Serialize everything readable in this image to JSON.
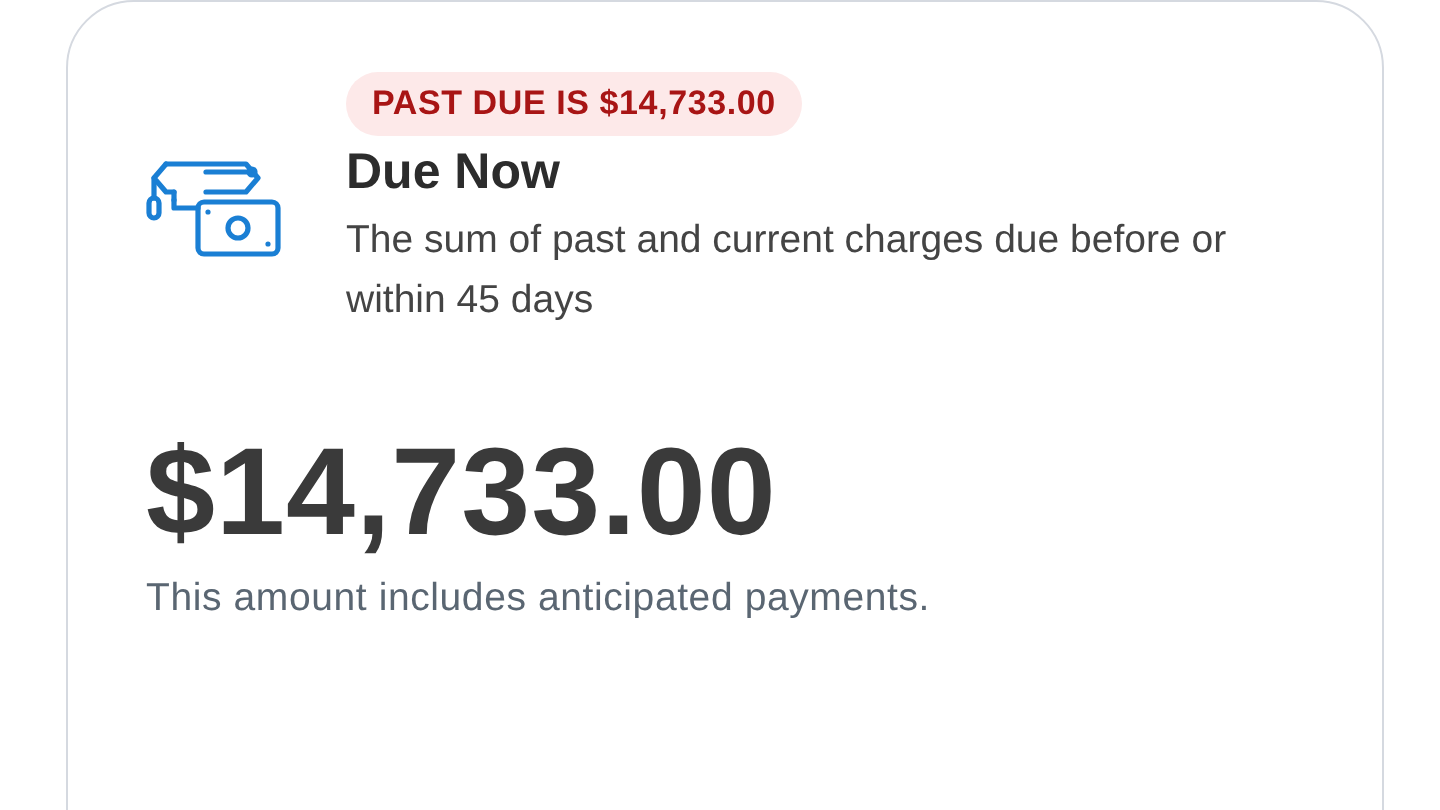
{
  "card": {
    "badge": "PAST DUE IS $14,733.00",
    "title": "Due Now",
    "description": "The sum of past and current charges due before or within 45 days",
    "amount": "$14,733.00",
    "note": "This amount includes anticipated payments."
  }
}
